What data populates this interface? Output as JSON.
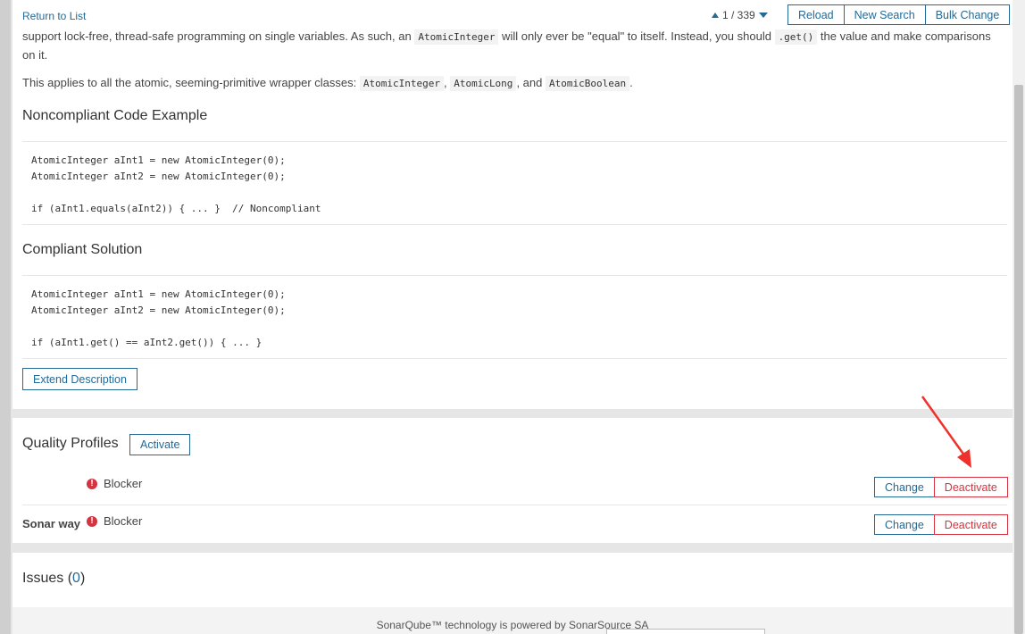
{
  "topbar": {
    "return_label": "Return to List",
    "pager_text": "1 / 339",
    "reload_label": "Reload",
    "new_search_label": "New Search",
    "bulk_change_label": "Bulk Change"
  },
  "description": {
    "para1_a": "support lock-free, thread-safe programming on single variables. As such, an ",
    "para1_code1": "AtomicInteger",
    "para1_b": " will only ever be \"equal\" to itself. Instead, you should ",
    "para1_code2": ".get()",
    "para1_c": " the value and make comparisons",
    "para1_d": "on it.",
    "para2_a": "This applies to all the atomic, seeming-primitive wrapper classes: ",
    "para2_code1": "AtomicInteger",
    "para2_sep1": ", ",
    "para2_code2": "AtomicLong",
    "para2_sep2": ", and ",
    "para2_code3": "AtomicBoolean",
    "para2_end": "."
  },
  "noncompliant": {
    "title": "Noncompliant Code Example",
    "code": "AtomicInteger aInt1 = new AtomicInteger(0);\nAtomicInteger aInt2 = new AtomicInteger(0);\n\nif (aInt1.equals(aInt2)) { ... }  // Noncompliant"
  },
  "compliant": {
    "title": "Compliant Solution",
    "code": "AtomicInteger aInt1 = new AtomicInteger(0);\nAtomicInteger aInt2 = new AtomicInteger(0);\n\nif (aInt1.get() == aInt2.get()) { ... }"
  },
  "extend_label": "Extend Description",
  "quality_profiles": {
    "title": "Quality Profiles",
    "activate_label": "Activate",
    "rows": [
      {
        "name": "",
        "severity": "Blocker",
        "change_label": "Change",
        "deactivate_label": "Deactivate"
      },
      {
        "name": "Sonar way",
        "severity": "Blocker",
        "change_label": "Change",
        "deactivate_label": "Deactivate"
      }
    ]
  },
  "issues": {
    "label": "Issues",
    "open_paren": " (",
    "count": "0",
    "close_paren": ")"
  },
  "footer": {
    "text": "SonarQube™ technology is powered by SonarSource SA"
  },
  "colors": {
    "link": "#236a97",
    "danger": "#d4333f",
    "annotation_arrow": "#f0302a"
  }
}
